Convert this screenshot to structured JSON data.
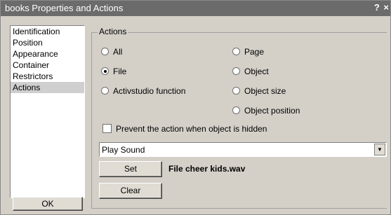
{
  "window": {
    "title": "books Properties and Actions",
    "help": "?",
    "close": "×"
  },
  "sidebar": {
    "items": [
      {
        "label": "Identification",
        "selected": false
      },
      {
        "label": "Position",
        "selected": false
      },
      {
        "label": "Appearance",
        "selected": false
      },
      {
        "label": "Container",
        "selected": false
      },
      {
        "label": "Restrictors",
        "selected": false
      },
      {
        "label": "Actions",
        "selected": true
      }
    ],
    "ok_label": "OK"
  },
  "actions": {
    "group_label": "Actions",
    "radios": {
      "all": {
        "label": "All",
        "checked": false
      },
      "page": {
        "label": "Page",
        "checked": false
      },
      "file": {
        "label": "File",
        "checked": true
      },
      "object": {
        "label": "Object",
        "checked": false
      },
      "activstudio": {
        "label": "Activstudio function",
        "checked": false
      },
      "object_size": {
        "label": "Object size",
        "checked": false
      },
      "object_position": {
        "label": "Object position",
        "checked": false
      }
    },
    "prevent_checkbox": {
      "label": "Prevent the action when object is hidden",
      "checked": false
    },
    "dropdown": {
      "value": "Play Sound"
    },
    "set_label": "Set",
    "file_text": "File cheer kids.wav",
    "clear_label": "Clear"
  }
}
